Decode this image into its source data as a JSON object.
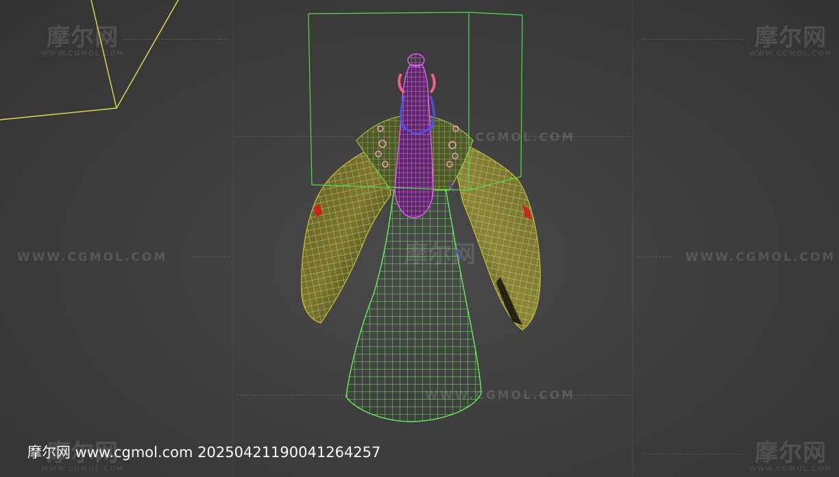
{
  "watermark": {
    "brand_cn": "摩尔网",
    "brand_url": "WWW.CGMOL.COM"
  },
  "caption": {
    "text": "摩尔网 www.cgmol.com 20250421190041264257"
  },
  "colors": {
    "viewport_bg": "#3e3e3e",
    "camera_outline": "#e6e04a",
    "bounding_box": "#52e04a",
    "dress_wire": "#66f45a",
    "sleeve_wire": "#c8c23a",
    "hair_wire": "#e060f0",
    "hairband_wire": "#5050f0",
    "flower_wire": "#f0a0c0",
    "sleeve_cuff": "#d02020"
  }
}
